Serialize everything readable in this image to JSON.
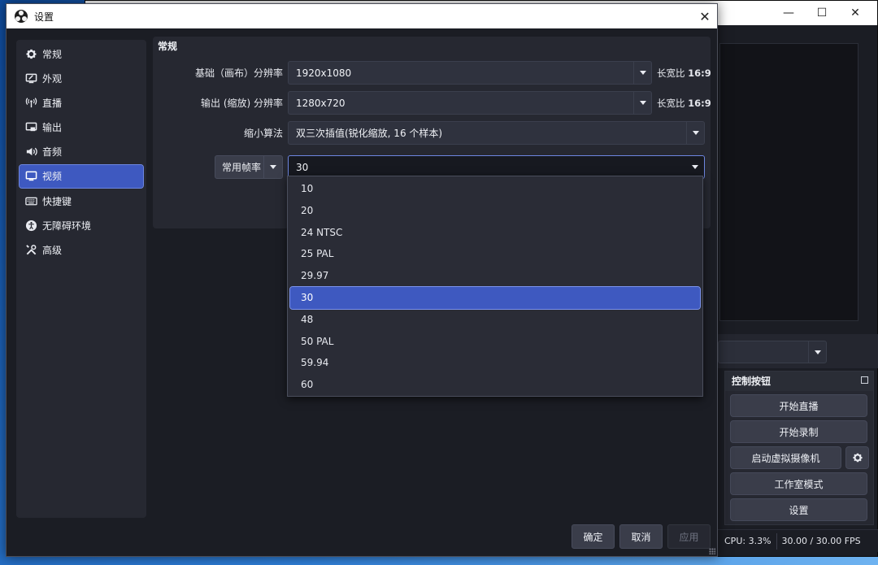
{
  "main_window": {
    "controls": {
      "minimize": "—",
      "maximize": "☐",
      "close": "✕"
    },
    "controls_dock": {
      "title": "控制按钮",
      "buttons": [
        "开始直播",
        "开始录制",
        "启动虚拟摄像机",
        "工作室模式",
        "设置"
      ]
    },
    "status": {
      "cpu": "CPU: 3.3%",
      "fps": "30.00 / 30.00 FPS"
    }
  },
  "dialog": {
    "title": "设置",
    "close": "✕",
    "sidebar": {
      "items": [
        {
          "label": "常规",
          "icon": "gear-icon"
        },
        {
          "label": "外观",
          "icon": "appearance-icon"
        },
        {
          "label": "直播",
          "icon": "broadcast-icon"
        },
        {
          "label": "输出",
          "icon": "output-icon"
        },
        {
          "label": "音频",
          "icon": "speaker-icon"
        },
        {
          "label": "视频",
          "icon": "monitor-icon",
          "active": true
        },
        {
          "label": "快捷键",
          "icon": "keyboard-icon"
        },
        {
          "label": "无障碍环境",
          "icon": "accessibility-icon"
        },
        {
          "label": "高级",
          "icon": "tools-icon"
        }
      ]
    },
    "video": {
      "group_title": "常规",
      "base_resolution": {
        "label": "基础（画布）分辨率",
        "value": "1920x1080",
        "aspect_prefix": "长宽比",
        "aspect_value": "16:9"
      },
      "output_resolution": {
        "label": "输出 (缩放) 分辨率",
        "value": "1280x720",
        "aspect_prefix": "长宽比",
        "aspect_value": "16:9"
      },
      "downscale_filter": {
        "label": "缩小算法",
        "value": "双三次插值(锐化缩放, 16 个样本)"
      },
      "fps": {
        "type_label": "常用帧率",
        "value": "30"
      }
    },
    "fps_options": [
      "10",
      "20",
      "24 NTSC",
      "25 PAL",
      "29.97",
      "30",
      "48",
      "50 PAL",
      "59.94",
      "60"
    ],
    "fps_selected": "30",
    "buttons": {
      "ok": "确定",
      "cancel": "取消",
      "apply": "应用"
    }
  },
  "colors": {
    "accent": "#3e59c0",
    "panel": "#262831",
    "background": "#1b1d24"
  }
}
